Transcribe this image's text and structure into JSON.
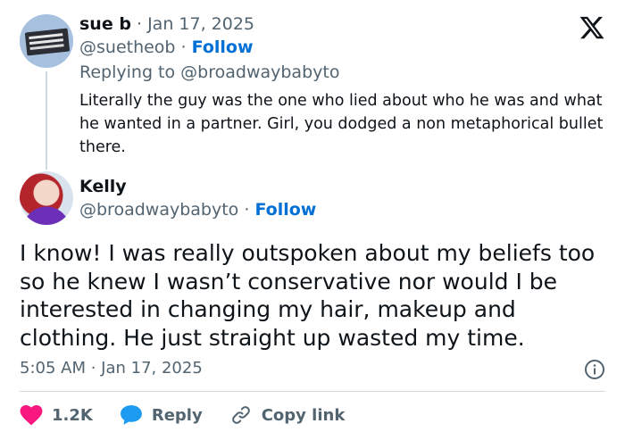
{
  "parent_tweet": {
    "name": "sue b",
    "date": "Jan 17, 2025",
    "handle": "@suetheob",
    "follow_label": "Follow",
    "replying_to": "Replying to @broadwaybabyto",
    "text": "Literally the guy was the one who lied about who he was and what he wanted in a partner. Girl, you dodged a non metaphorical bullet there."
  },
  "main_tweet": {
    "name": "Kelly",
    "handle": "@broadwaybabyto",
    "follow_label": "Follow",
    "text": "I know! I was really outspoken about my beliefs too so he knew I wasn’t conservative nor would I be interested in changing my hair, makeup and clothing. He just straight up wasted my time.",
    "timestamp": "5:05 AM · Jan 17, 2025"
  },
  "actions": {
    "like_count": "1.2K",
    "reply_label": "Reply",
    "copy_link_label": "Copy link"
  },
  "colors": {
    "like": "#f91880",
    "reply": "#1d9bf0",
    "follow": "#006fd6",
    "muted": "#536471"
  },
  "icons": [
    "x-logo-icon",
    "heart-icon",
    "reply-bubble-icon",
    "link-icon",
    "info-icon"
  ]
}
